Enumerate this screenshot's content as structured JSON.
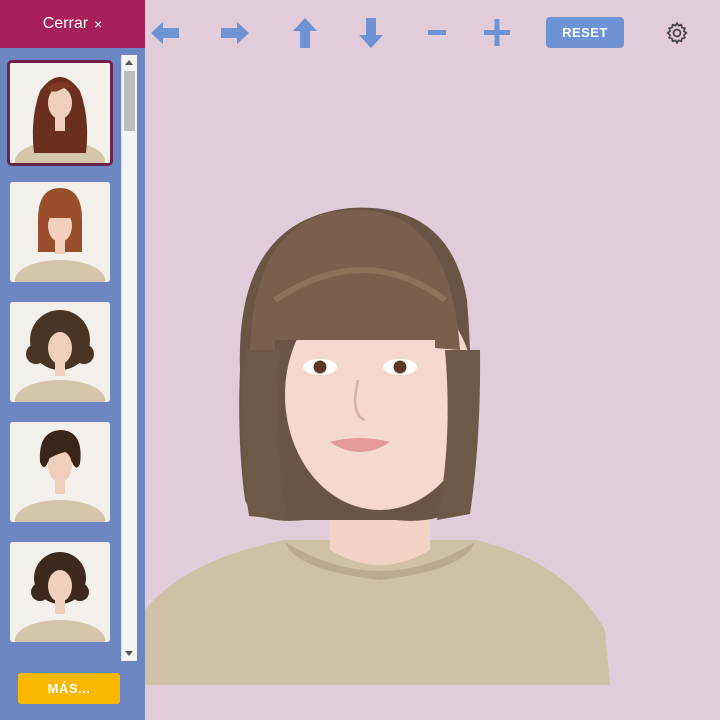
{
  "sidebar": {
    "close_label": "Cerrar",
    "close_icon": "×",
    "more_label": "MÁS...",
    "thumbnails": [
      {
        "style": "long-wavy-auburn",
        "selected": true
      },
      {
        "style": "bob-bangs-auburn",
        "selected": false
      },
      {
        "style": "curly-medium-brown",
        "selected": false
      },
      {
        "style": "short-wavy-dark",
        "selected": false
      },
      {
        "style": "short-curly-brown",
        "selected": false
      }
    ]
  },
  "toolbar": {
    "buttons": [
      "arrow-left-icon",
      "arrow-right-icon",
      "arrow-up-icon",
      "arrow-down-icon",
      "minus-icon",
      "plus-icon"
    ],
    "reset_label": "RESET",
    "settings_icon": "gear-icon"
  },
  "colors": {
    "background": "#e2ccd9",
    "sidebar": "#6b86c0",
    "close_tab": "#a8205a",
    "more_button": "#fbb800",
    "reset_button": "#6d93d4",
    "arrow_icons": "#6d93d4"
  }
}
